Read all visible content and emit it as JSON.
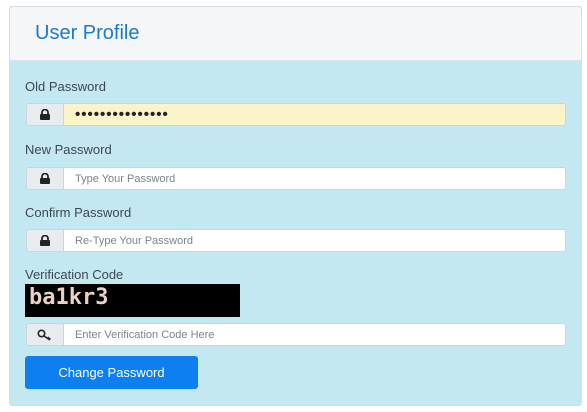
{
  "panel": {
    "title": "User Profile"
  },
  "old_password": {
    "label": "Old Password",
    "value": "•••••••••••••••",
    "icon": "lock-icon"
  },
  "new_password": {
    "label": "New Password",
    "placeholder": "Type Your Password",
    "icon": "lock-icon"
  },
  "confirm_password": {
    "label": "Confirm Password",
    "placeholder": "Re-Type Your Password",
    "icon": "lock-icon"
  },
  "verification": {
    "label": "Verification Code",
    "captcha_text": "ba1kr3",
    "placeholder": "Enter Verification Code Here",
    "icon": "key-icon"
  },
  "submit": {
    "label": "Change Password"
  },
  "colors": {
    "accent": "#0d7ff0",
    "title": "#1b7bc7",
    "panel_body": "#c3e8f1",
    "autofill": "#fbf4c8"
  }
}
